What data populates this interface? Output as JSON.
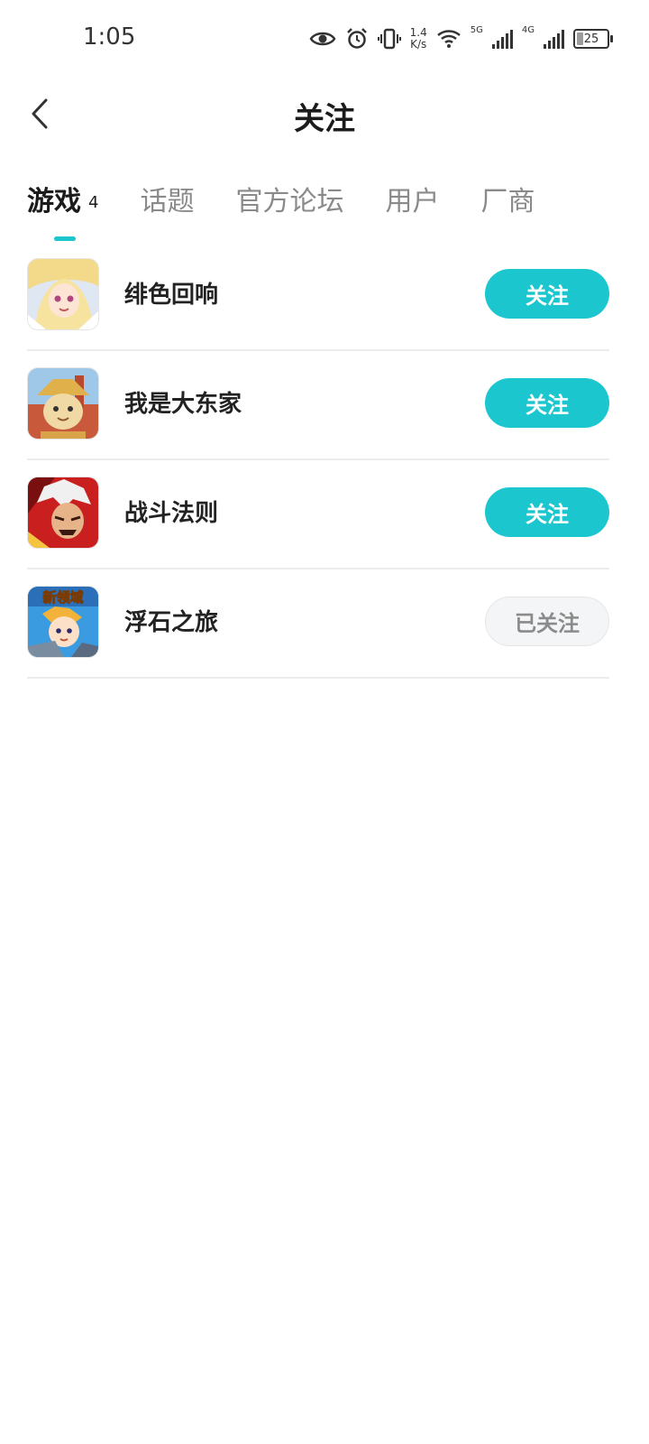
{
  "status_bar": {
    "time": "1:05",
    "speed_value": "1.4",
    "speed_unit": "K/s",
    "net1": "5G",
    "net2": "4G",
    "battery": "25"
  },
  "header": {
    "title": "关注"
  },
  "tabs": [
    {
      "label": "游戏",
      "count": "4",
      "active": true
    },
    {
      "label": "话题"
    },
    {
      "label": "官方论坛"
    },
    {
      "label": "用户"
    },
    {
      "label": "厂商"
    }
  ],
  "games": [
    {
      "name": "绯色回响",
      "button": "关注",
      "followed": false
    },
    {
      "name": "我是大东家",
      "button": "关注",
      "followed": false
    },
    {
      "name": "战斗法则",
      "button": "关注",
      "followed": false
    },
    {
      "name": "浮石之旅",
      "button": "已关注",
      "followed": true,
      "icon_text": "新领域"
    }
  ],
  "colors": {
    "accent": "#1bc6cf",
    "followed_bg": "#f4f5f6",
    "followed_text": "#8b8b8b"
  }
}
